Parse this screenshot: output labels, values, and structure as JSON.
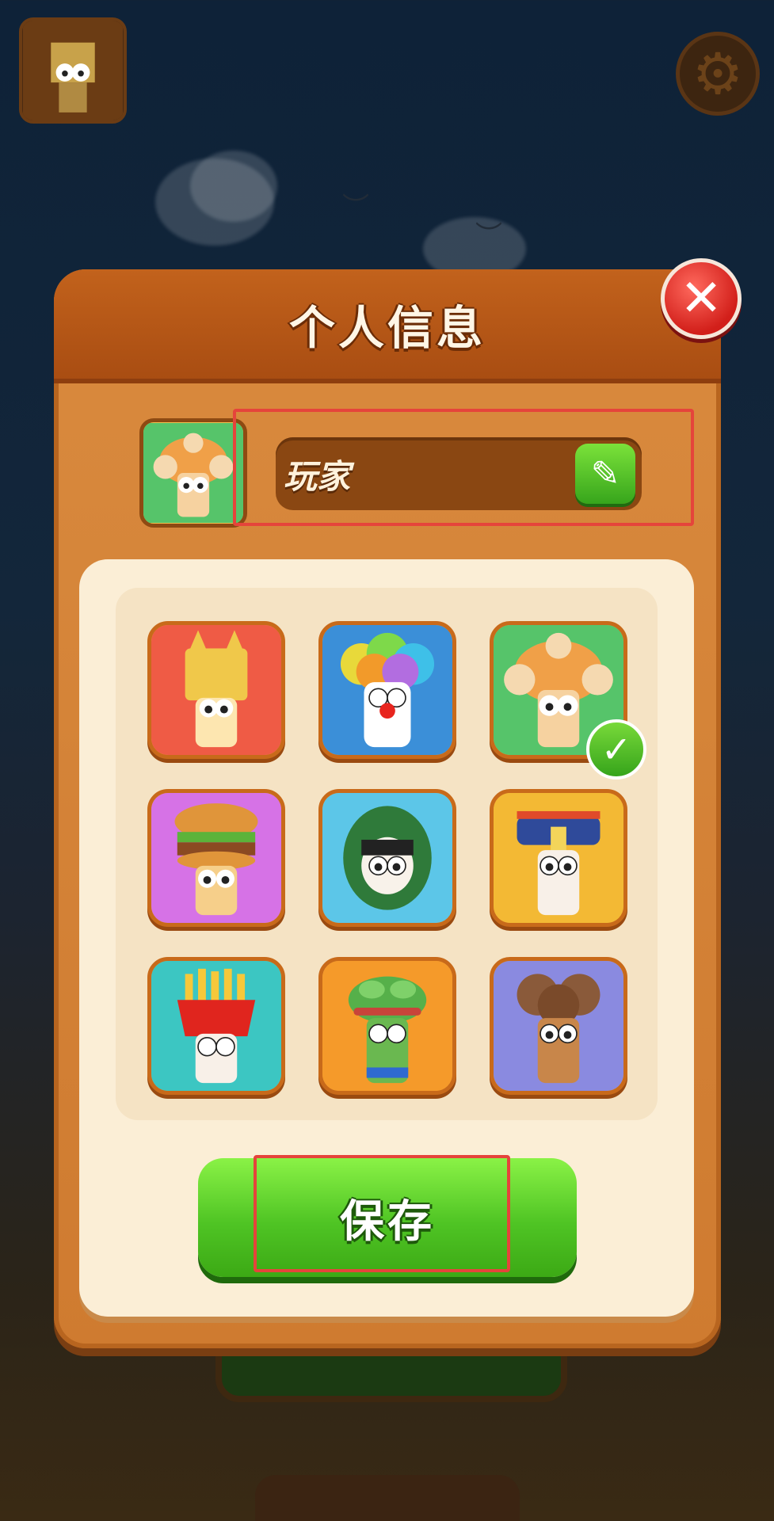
{
  "header": {
    "title": "个人信息"
  },
  "profile": {
    "name": "玩家",
    "selected_avatar_index": 2
  },
  "avatars": [
    {
      "name": "dog-character"
    },
    {
      "name": "clown-character"
    },
    {
      "name": "monkey-hat-character"
    },
    {
      "name": "burger-character"
    },
    {
      "name": "green-hood-character"
    },
    {
      "name": "qing-official-character"
    },
    {
      "name": "fries-character"
    },
    {
      "name": "frog-character"
    },
    {
      "name": "curly-hair-character"
    }
  ],
  "actions": {
    "save_label": "保存"
  },
  "icons": {
    "close": "close-icon",
    "edit": "pencil-icon",
    "settings": "gear-icon",
    "selected": "checkmark-icon"
  },
  "colors": {
    "panel": "#cf7b30",
    "header": "#a94d12",
    "save_green": "#4fc424",
    "close_red": "#d21f1a",
    "highlight": "#e5443b"
  }
}
